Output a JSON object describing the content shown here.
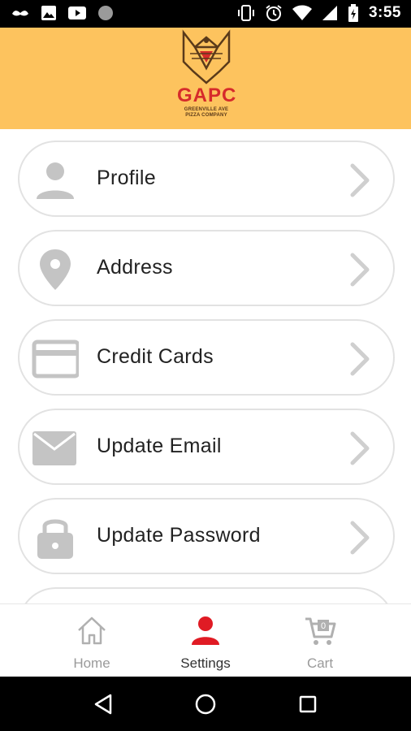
{
  "status_bar": {
    "time": "3:55",
    "left_icons": [
      "mustache-icon",
      "image-icon",
      "youtube-icon",
      "circle-icon"
    ],
    "right_icons": [
      "vibrate-icon",
      "alarm-icon",
      "wifi-icon",
      "signal-icon",
      "battery-icon"
    ]
  },
  "header": {
    "logo_text": "GAPC",
    "logo_subtext_line1": "GREENVILLE AVE",
    "logo_subtext_line2": "PIZZA COMPANY",
    "background": "#fdc35e"
  },
  "menu": {
    "items": [
      {
        "label": "Profile",
        "icon": "person-icon"
      },
      {
        "label": "Address",
        "icon": "location-pin-icon"
      },
      {
        "label": "Credit Cards",
        "icon": "credit-card-icon"
      },
      {
        "label": "Update Email",
        "icon": "mail-icon"
      },
      {
        "label": "Update Password",
        "icon": "lock-icon"
      }
    ]
  },
  "bottom_nav": {
    "items": [
      {
        "label": "Home",
        "icon": "home-icon",
        "active": false
      },
      {
        "label": "Settings",
        "icon": "settings-person-icon",
        "active": true
      },
      {
        "label": "Cart",
        "icon": "cart-icon",
        "active": false,
        "badge": "0"
      }
    ],
    "active_color": "#e01b24"
  }
}
